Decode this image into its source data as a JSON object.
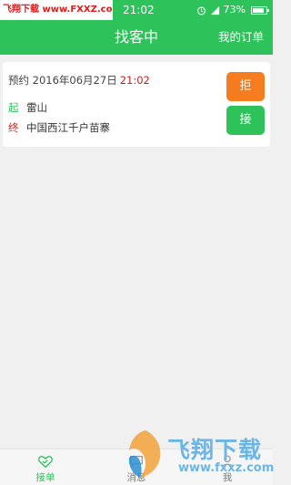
{
  "status_bar": {
    "watermark_text": "飞翔下载 www.FXXZ.com",
    "time": "21:02",
    "battery": "73%"
  },
  "header": {
    "title": "找客中",
    "orders_link": "我的订单"
  },
  "order": {
    "prefix": "预约",
    "date": "2016年06月27日",
    "time": "21:02",
    "start_marker": "起",
    "start": "雷山",
    "end_marker": "终",
    "end": "中国西江千户苗寨",
    "reject_label": "拒",
    "accept_label": "接"
  },
  "tabs": [
    {
      "label": "接单",
      "icon": "handshake-icon",
      "active": true
    },
    {
      "label": "消息",
      "icon": "message-icon",
      "active": false
    },
    {
      "label": "我",
      "icon": "person-icon",
      "active": false
    }
  ],
  "overlay_logo": {
    "text": "飞翔下载",
    "url": "www.fxxz.com"
  },
  "colors": {
    "brand": "#2dc25a",
    "reject": "#f57d1f",
    "highlight": "#c81e1e"
  }
}
